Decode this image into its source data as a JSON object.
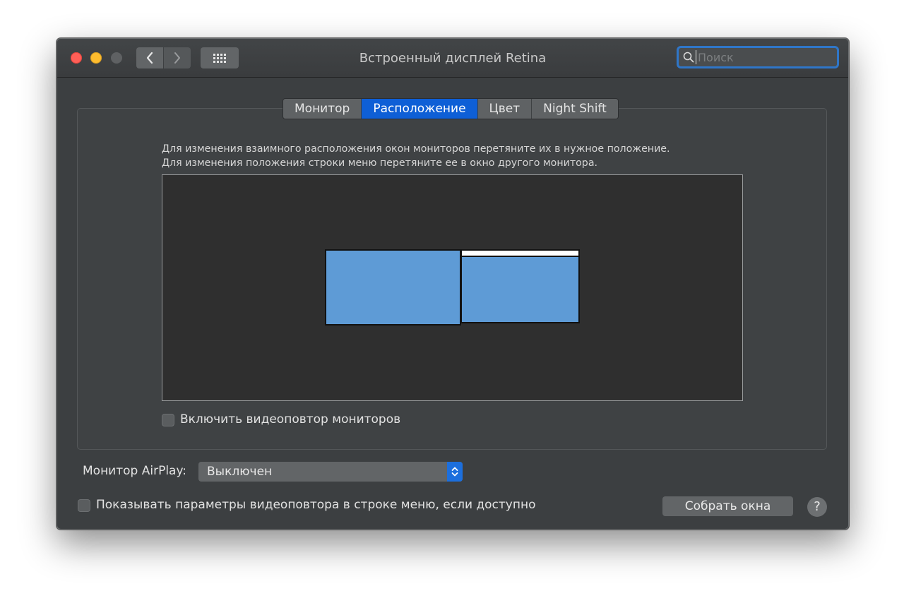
{
  "window": {
    "title": "Встроенный дисплей Retina",
    "search_placeholder": "Поиск"
  },
  "tabs": [
    {
      "label": "Монитор",
      "active": false
    },
    {
      "label": "Расположение",
      "active": true
    },
    {
      "label": "Цвет",
      "active": false
    },
    {
      "label": "Night Shift",
      "active": false
    }
  ],
  "arrangement": {
    "hint_line1": "Для изменения взаимного расположения окон мониторов перетяните их в нужное положение.",
    "hint_line2": "Для изменения положения строки меню перетяните ее в окно другого монитора.",
    "mirror_label": "Включить видеоповтор мониторов",
    "mirror_checked": false
  },
  "airplay": {
    "label": "Монитор AirPlay:",
    "selected": "Выключен"
  },
  "footer": {
    "show_mirroring_label": "Показывать параметры видеоповтора в строке меню, если доступно",
    "show_mirroring_checked": false,
    "gather_button": "Собрать окна",
    "help": "?"
  },
  "colors": {
    "accent": "#0e5fd6",
    "monitor_fill": "#5e9bd6",
    "window_bg": "#3c3f41"
  }
}
